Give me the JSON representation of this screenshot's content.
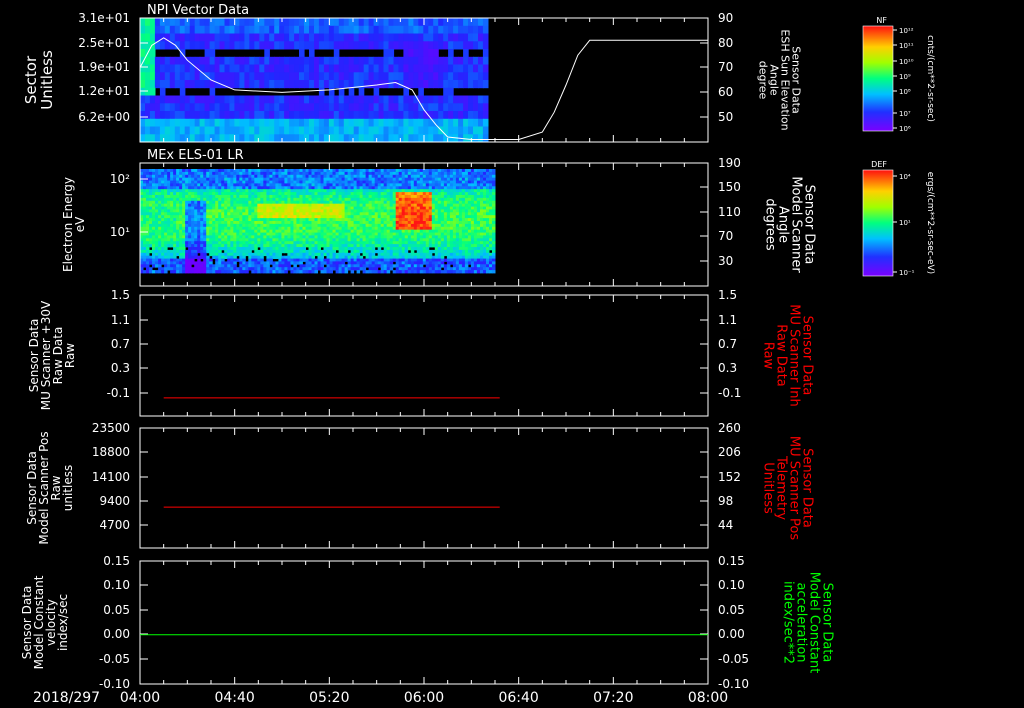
{
  "date": "2018/297",
  "x_tick_labels": [
    "04:00",
    "04:40",
    "05:20",
    "06:00",
    "06:40",
    "07:20",
    "08:00"
  ],
  "colors": {
    "background": "#000000",
    "axis": "#ffffff",
    "red_trace": "#ff0000",
    "green_trace": "#00ff00",
    "white_trace": "#ffffff"
  },
  "colorbars": [
    {
      "label": "NF",
      "unit": "cnts/(cm**2-sr-sec)",
      "ticks": [
        "10¹²",
        "10¹¹",
        "10¹⁰",
        "10⁹",
        "10⁸",
        "10⁷",
        "10⁶"
      ]
    },
    {
      "label": "DEF",
      "unit": "ergs/(cm**2-sr-sec-eV)",
      "ticks": [
        "10⁴",
        "10¹",
        "10⁻¹"
      ]
    }
  ],
  "chart_data": [
    {
      "type": "heatmap",
      "title": "NPI Vector Data",
      "ylabel": [
        "Sector",
        "Unitless"
      ],
      "y_tick_labels": [
        "3.1e+01",
        "2.5e+01",
        "1.9e+01",
        "1.2e+01",
        "6.2e+00"
      ],
      "y2label": [
        "Sensor Data",
        "ESH Sun Elevation",
        "Angle",
        "degree"
      ],
      "y2_tick_labels": [
        "90",
        "80",
        "70",
        "60",
        "50"
      ],
      "y2lim": [
        40,
        90
      ],
      "data_coverage_end": "06:27",
      "series": [
        {
          "name": "ESH Sun Elevation Angle",
          "axis": "right",
          "x": [
            "04:00",
            "04:05",
            "04:10",
            "04:15",
            "04:20",
            "04:30",
            "04:40",
            "05:00",
            "05:20",
            "05:40",
            "05:48",
            "05:55",
            "06:00",
            "06:05",
            "06:10",
            "06:20",
            "06:40",
            "06:50",
            "06:55",
            "07:00",
            "07:05",
            "07:10",
            "07:20",
            "07:40",
            "08:00"
          ],
          "y": [
            70,
            79,
            82,
            79,
            73,
            65,
            61,
            60,
            61,
            63,
            64,
            61,
            53,
            47,
            42,
            41,
            41,
            44,
            52,
            63,
            75,
            81,
            81,
            81,
            81
          ]
        }
      ]
    },
    {
      "type": "heatmap",
      "title": "MEx ELS-01 LR",
      "ylabel": [
        "Electron Energy",
        "eV"
      ],
      "y_tick_labels": [
        "10²",
        "10¹"
      ],
      "y2label": [
        "Sensor Data",
        "Model Scanner",
        "Angle",
        "degrees"
      ],
      "y2_tick_labels": [
        "190",
        "150",
        "110",
        "70",
        "30"
      ],
      "y2lim": [
        10,
        190
      ],
      "data_coverage_end": "06:30",
      "series": [
        {
          "name": "Model Scanner Angle",
          "axis": "right",
          "x": [
            "04:00",
            "08:00"
          ],
          "y": [
            10,
            10
          ]
        }
      ]
    },
    {
      "type": "line",
      "ylabel": [
        "Sensor Data",
        "MU Scanner +30V",
        "Raw Data",
        "Raw"
      ],
      "y_tick_labels": [
        "1.5",
        "1.1",
        "0.7",
        "0.3",
        "-0.1"
      ],
      "ylim": [
        -0.3,
        1.5
      ],
      "y2label": [
        "Sensor Data",
        "MU Scanner Inh",
        "Raw Data",
        "Raw"
      ],
      "y2_tick_labels": [
        "1.5",
        "1.1",
        "0.7",
        "0.3",
        "-0.1"
      ],
      "y2lim": [
        -0.3,
        1.5
      ],
      "series": [
        {
          "name": "MU Scanner Inh Raw Data",
          "axis": "right",
          "x": [
            "04:10",
            "06:32"
          ],
          "y": [
            -0.03,
            -0.03
          ]
        }
      ]
    },
    {
      "type": "line",
      "ylabel": [
        "Sensor Data",
        "Model Scanner Pos",
        "Raw",
        "unitless"
      ],
      "y_tick_labels": [
        "23500",
        "18800",
        "14100",
        "9400",
        "4700"
      ],
      "ylim": [
        0,
        23500
      ],
      "y2label": [
        "Sensor Data",
        "MU Scanner Pos",
        "Telemetry",
        "Unitless"
      ],
      "y2_tick_labels": [
        "260",
        "206",
        "152",
        "98",
        "44"
      ],
      "y2lim": [
        -10,
        260
      ],
      "series": [
        {
          "name": "MU Scanner Pos Telemetry",
          "axis": "right",
          "x": [
            "04:10",
            "06:32"
          ],
          "y": [
            82,
            82
          ]
        }
      ]
    },
    {
      "type": "line",
      "ylabel": [
        "Sensor Data",
        "Model Constant",
        "velocity",
        "index/sec"
      ],
      "y_tick_labels": [
        "0.15",
        "0.10",
        "0.05",
        "0.00",
        "-0.05",
        "-0.10"
      ],
      "ylim": [
        -0.1,
        0.15
      ],
      "y2label": [
        "Sensor Data",
        "Model Constant",
        "acceleration",
        "index/sec**2"
      ],
      "y2_tick_labels": [
        "0.15",
        "0.10",
        "0.05",
        "0.00",
        "-0.05",
        "-0.10"
      ],
      "y2lim": [
        -0.1,
        0.15
      ],
      "series": [
        {
          "name": "Model Constant acceleration",
          "axis": "right",
          "x": [
            "04:00",
            "08:00"
          ],
          "y": [
            0,
            0
          ]
        }
      ]
    }
  ]
}
